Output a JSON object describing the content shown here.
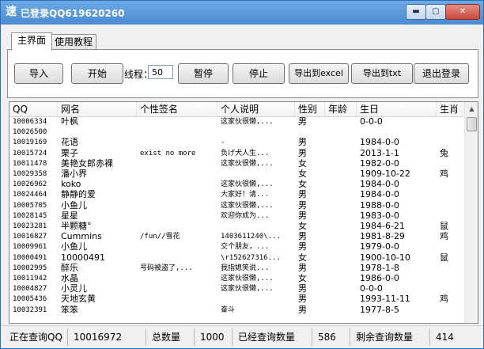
{
  "window": {
    "title": "已登录QQ619620260",
    "icon": "速",
    "min": "▬",
    "max": "▢",
    "close": "✕"
  },
  "tabs": [
    {
      "label": "主界面"
    },
    {
      "label": "使用教程"
    }
  ],
  "toolbar": {
    "import": "导入",
    "start": "开始",
    "threads_label": "线程：",
    "threads_value": "50",
    "pause": "暂停",
    "stop": "停止",
    "export_excel": "导出到excel",
    "export_txt": "导出到txt",
    "logout": "退出登录"
  },
  "table": {
    "columns": [
      "QQ",
      "网名",
      "个性签名",
      "个人说明",
      "性别",
      "年龄",
      "生日",
      "生肖"
    ],
    "rows": [
      [
        "10006334",
        "叶枫",
        "",
        "这家伙很懒,...",
        "男",
        "",
        "0-0-0",
        ""
      ],
      [
        "10026500",
        "",
        "",
        "",
        "",
        "",
        "",
        ""
      ],
      [
        "10019169",
        "花语",
        "",
        "-",
        "男",
        "",
        "1984-0-0",
        ""
      ],
      [
        "10015724",
        "栗子",
        "exist no more",
        "负げ犬人生...",
        "男",
        "",
        "2013-1-1",
        "兔"
      ],
      [
        "10011478",
        "美艳女郎赤裸",
        "",
        "这家伙很懒,...",
        "女",
        "",
        "1982-0-0",
        ""
      ],
      [
        "10029358",
        "潘小界",
        "",
        "",
        "女",
        "",
        "1909-10-22",
        "鸡"
      ],
      [
        "10026962",
        "koko",
        "",
        "这家伙很懒,...",
        "女",
        "",
        "1984-0-0",
        ""
      ],
      [
        "10024464",
        "静静的爱",
        "",
        "大家好！请...",
        "男",
        "",
        "1984-0-0",
        ""
      ],
      [
        "10005705",
        "小鱼儿",
        "",
        "这家伙很懒,...",
        "男",
        "",
        "1988-0-0",
        ""
      ],
      [
        "10028145",
        "星星",
        "",
        "欢迎你成为...",
        "男",
        "",
        "1983-0-0",
        ""
      ],
      [
        "10023281",
        "半颗糖°",
        "",
        "",
        "女",
        "",
        "1984-6-21",
        "鼠"
      ],
      [
        "10016827",
        "Cummins",
        "/fun//雪花",
        "1403611240\\...",
        "男",
        "",
        "1981-8-29",
        "鸡"
      ],
      [
        "10009961",
        "小鱼儿",
        "",
        "交个朋友，...",
        "男",
        "",
        "1979-0-0",
        ""
      ],
      [
        "10000491",
        "10000491",
        "",
        "\\r152627316...",
        "女",
        "",
        "1900-10-10",
        "鼠"
      ],
      [
        "10002995",
        "醉乐",
        "号码被盗了,...",
        "我指媳笑说...",
        "男",
        "",
        "1978-1-8",
        ""
      ],
      [
        "10011942",
        "水晶",
        "",
        "这家伙很懒,...",
        "女",
        "",
        "1986-0-0",
        ""
      ],
      [
        "10004827",
        "小灵儿",
        "",
        "这家伙很懒,...",
        "男",
        "",
        "0-0-0",
        ""
      ],
      [
        "10005436",
        "天地玄黄",
        "",
        "",
        "男",
        "",
        "1993-11-11",
        "鸡"
      ],
      [
        "10032391",
        "笨笨",
        "",
        "奋斗",
        "男",
        "",
        "1977-8-5",
        ""
      ]
    ]
  },
  "scrollbar": {
    "up": "▲"
  },
  "status": {
    "querying_label": "正在查询QQ",
    "querying_value": "10016972",
    "total_label": "总数量",
    "total_value": "1000",
    "done_label": "已经查询数量",
    "done_value": "586",
    "remaining_label": "剩余查询数量",
    "remaining_value": "414"
  }
}
